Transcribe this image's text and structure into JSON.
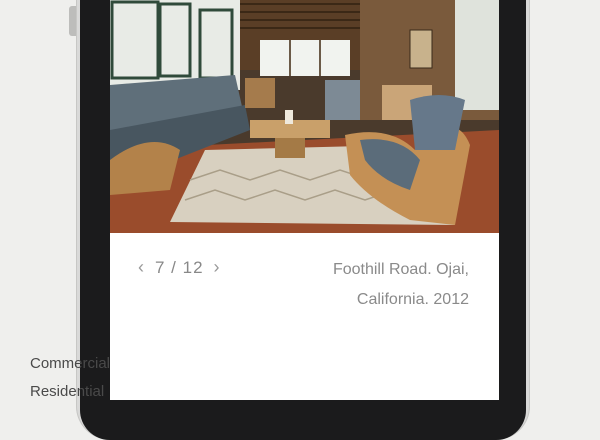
{
  "gallery": {
    "prev_icon": "chevron-left-icon",
    "next_icon": "chevron-right-icon",
    "counter": "7 / 12",
    "caption_line1": "Foothill Road. Ojai,",
    "caption_line2": "California. 2012"
  },
  "menu": {
    "items": [
      {
        "label": "Commercial"
      },
      {
        "label": "Residential"
      }
    ]
  },
  "colors": {
    "background": "#efefed",
    "phone_bezel": "#1b1b1c",
    "text_muted": "#888888",
    "text_dark": "#4a4a4a"
  }
}
